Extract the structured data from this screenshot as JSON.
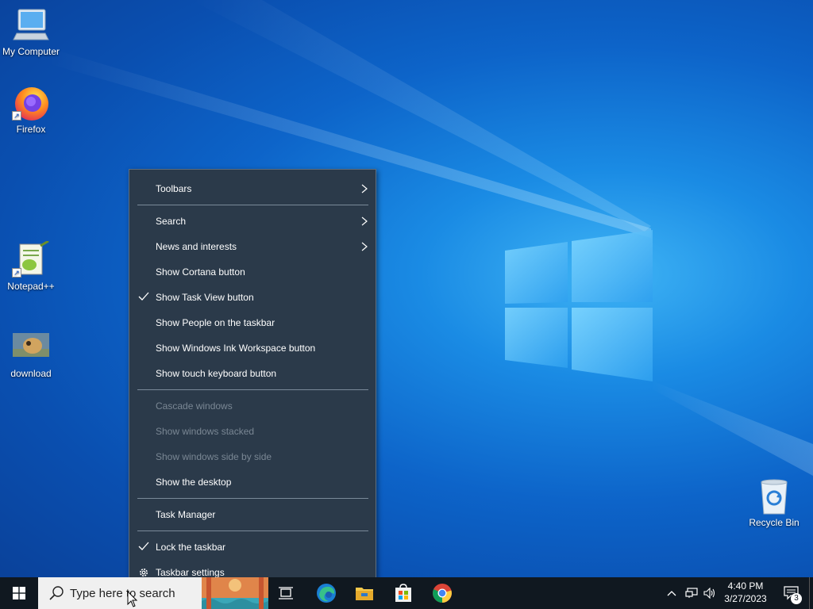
{
  "desktop": {
    "icons": [
      {
        "label": "My Computer",
        "icon": "computer-icon"
      },
      {
        "label": "Firefox",
        "icon": "firefox-icon"
      },
      {
        "label": "Notepad++",
        "icon": "notepadpp-icon"
      },
      {
        "label": "download",
        "icon": "image-file-icon"
      },
      {
        "label": "Recycle Bin",
        "icon": "recycle-bin-icon"
      }
    ]
  },
  "context_menu": {
    "items": [
      {
        "label": "Toolbars",
        "submenu": true,
        "checked": false,
        "enabled": true
      },
      {
        "label": "Search",
        "submenu": true,
        "checked": false,
        "enabled": true
      },
      {
        "label": "News and interests",
        "submenu": true,
        "checked": false,
        "enabled": true
      },
      {
        "label": "Show Cortana button",
        "submenu": false,
        "checked": false,
        "enabled": true
      },
      {
        "label": "Show Task View button",
        "submenu": false,
        "checked": true,
        "enabled": true
      },
      {
        "label": "Show People on the taskbar",
        "submenu": false,
        "checked": false,
        "enabled": true
      },
      {
        "label": "Show Windows Ink Workspace button",
        "submenu": false,
        "checked": false,
        "enabled": true
      },
      {
        "label": "Show touch keyboard button",
        "submenu": false,
        "checked": false,
        "enabled": true
      },
      {
        "label": "Cascade windows",
        "submenu": false,
        "checked": false,
        "enabled": false
      },
      {
        "label": "Show windows stacked",
        "submenu": false,
        "checked": false,
        "enabled": false
      },
      {
        "label": "Show windows side by side",
        "submenu": false,
        "checked": false,
        "enabled": false
      },
      {
        "label": "Show the desktop",
        "submenu": false,
        "checked": false,
        "enabled": true
      },
      {
        "label": "Task Manager",
        "submenu": false,
        "checked": false,
        "enabled": true
      },
      {
        "label": "Lock the taskbar",
        "submenu": false,
        "checked": true,
        "enabled": true
      },
      {
        "label": "Taskbar settings",
        "submenu": false,
        "checked": false,
        "enabled": true,
        "icon": "gear-icon"
      }
    ]
  },
  "taskbar": {
    "search_placeholder": "Type here to search",
    "pinned": [
      "task-view-icon",
      "edge-icon",
      "file-explorer-icon",
      "store-icon",
      "chrome-icon"
    ],
    "clock_time": "4:40 PM",
    "clock_date": "3/27/2023",
    "notification_count": "3"
  },
  "colors": {
    "menu_bg": "#2b3a4a",
    "taskbar_bg": "#101820",
    "desktop_accent": "#0d64c9"
  }
}
